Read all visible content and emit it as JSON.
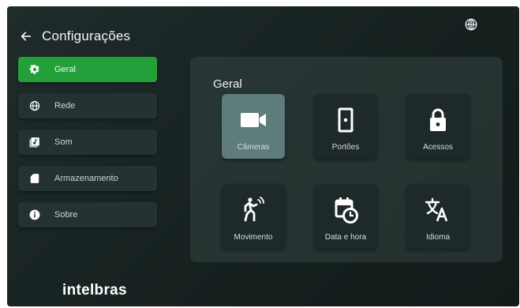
{
  "header": {
    "title": "Configurações"
  },
  "menu": {
    "items": [
      {
        "label": "Geral",
        "icon": "gear-icon",
        "active": true
      },
      {
        "label": "Rede",
        "icon": "globe-icon",
        "active": false
      },
      {
        "label": "Som",
        "icon": "music-icon",
        "active": false
      },
      {
        "label": "Armazenamento",
        "icon": "sd-card-icon",
        "active": false
      },
      {
        "label": "Sobre",
        "icon": "info-icon",
        "active": false
      }
    ]
  },
  "panel": {
    "title": "Geral",
    "tiles": [
      {
        "label": "Câmeras",
        "icon": "camera-icon",
        "selected": true
      },
      {
        "label": "Portões",
        "icon": "door-icon",
        "selected": false
      },
      {
        "label": "Acessos",
        "icon": "lock-icon",
        "selected": false
      },
      {
        "label": "Movimento",
        "icon": "motion-icon",
        "selected": false
      },
      {
        "label": "Data e hora",
        "icon": "calendar-clock-icon",
        "selected": false
      },
      {
        "label": "Idioma",
        "icon": "translate-icon",
        "selected": false
      }
    ]
  },
  "brand": "intelbras",
  "colors": {
    "accent": "#24a03a",
    "background": "#1a2524",
    "selected_tile": "#5d7c7a"
  }
}
